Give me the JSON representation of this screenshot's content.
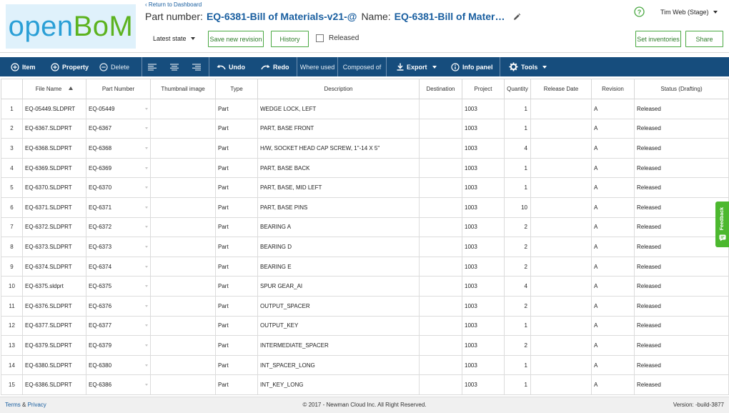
{
  "header": {
    "logo": {
      "open": "open",
      "bom": "BoM"
    },
    "return_link": "‹ Return to Dashboard",
    "part_number_label": "Part number:",
    "part_number_value": "EQ-6381-Bill of Materials-v21-@",
    "name_label": "Name:",
    "name_value": "EQ-6381-Bill of Mater…",
    "state_dropdown": "Latest state",
    "save_revision_label": "Save new revision",
    "history_label": "History",
    "released_label": "Released",
    "released_checked": false,
    "user": "Tim Web (Stage)",
    "set_inventories_label": "Set inventories",
    "share_label": "Share"
  },
  "toolbar": {
    "item": "Item",
    "property": "Property",
    "delete": "Delete",
    "undo": "Undo",
    "redo": "Redo",
    "where_used": "Where used",
    "composed_of": "Composed of",
    "export": "Export",
    "info_panel": "Info panel",
    "tools": "Tools"
  },
  "table": {
    "columns": [
      "",
      "File Name",
      "Part Number",
      "Thumbnail image",
      "Type",
      "Description",
      "Destination",
      "Project",
      "Quantity",
      "Release Date",
      "Revision",
      "Status (Drafting)"
    ],
    "sorted_column": "File Name",
    "rows": [
      {
        "n": "1",
        "file": "EQ-05449.SLDPRT",
        "part": "EQ-05449",
        "thumb": "",
        "type": "Part",
        "desc": "WEDGE LOCK, LEFT",
        "dest": "",
        "project": "1003",
        "qty": "1",
        "date": "",
        "rev": "A",
        "status": "Released"
      },
      {
        "n": "2",
        "file": "EQ-6367.SLDPRT",
        "part": "EQ-6367",
        "thumb": "",
        "type": "Part",
        "desc": "PART, BASE FRONT",
        "dest": "",
        "project": "1003",
        "qty": "1",
        "date": "",
        "rev": "A",
        "status": "Released"
      },
      {
        "n": "3",
        "file": "EQ-6368.SLDPRT",
        "part": "EQ-6368",
        "thumb": "",
        "type": "Part",
        "desc": "H/W, SOCKET HEAD CAP SCREW, 1\"-14 X 5\"",
        "dest": "",
        "project": "1003",
        "qty": "4",
        "date": "",
        "rev": "A",
        "status": "Released"
      },
      {
        "n": "4",
        "file": "EQ-6369.SLDPRT",
        "part": "EQ-6369",
        "thumb": "",
        "type": "Part",
        "desc": "PART, BASE BACK",
        "dest": "",
        "project": "1003",
        "qty": "1",
        "date": "",
        "rev": "A",
        "status": "Released"
      },
      {
        "n": "5",
        "file": "EQ-6370.SLDPRT",
        "part": "EQ-6370",
        "thumb": "",
        "type": "Part",
        "desc": "PART, BASE, MID LEFT",
        "dest": "",
        "project": "1003",
        "qty": "1",
        "date": "",
        "rev": "A",
        "status": "Released"
      },
      {
        "n": "6",
        "file": "EQ-6371.SLDPRT",
        "part": "EQ-6371",
        "thumb": "",
        "type": "Part",
        "desc": "PART, BASE PINS",
        "dest": "",
        "project": "1003",
        "qty": "10",
        "date": "",
        "rev": "A",
        "status": "Released"
      },
      {
        "n": "7",
        "file": "EQ-6372.SLDPRT",
        "part": "EQ-6372",
        "thumb": "",
        "type": "Part",
        "desc": "BEARING A",
        "dest": "",
        "project": "1003",
        "qty": "2",
        "date": "",
        "rev": "A",
        "status": "Released"
      },
      {
        "n": "8",
        "file": "EQ-6373.SLDPRT",
        "part": "EQ-6373",
        "thumb": "",
        "type": "Part",
        "desc": "BEARING D",
        "dest": "",
        "project": "1003",
        "qty": "2",
        "date": "",
        "rev": "A",
        "status": "Released"
      },
      {
        "n": "9",
        "file": "EQ-6374.SLDPRT",
        "part": "EQ-6374",
        "thumb": "",
        "type": "Part",
        "desc": "BEARING E",
        "dest": "",
        "project": "1003",
        "qty": "2",
        "date": "",
        "rev": "A",
        "status": "Released"
      },
      {
        "n": "10",
        "file": "EQ-6375.sldprt",
        "part": "EQ-6375",
        "thumb": "",
        "type": "Part",
        "desc": "SPUR GEAR_AI",
        "dest": "",
        "project": "1003",
        "qty": "4",
        "date": "",
        "rev": "A",
        "status": "Released"
      },
      {
        "n": "11",
        "file": "EQ-6376.SLDPRT",
        "part": "EQ-6376",
        "thumb": "",
        "type": "Part",
        "desc": "OUTPUT_SPACER",
        "dest": "",
        "project": "1003",
        "qty": "2",
        "date": "",
        "rev": "A",
        "status": "Released"
      },
      {
        "n": "12",
        "file": "EQ-6377.SLDPRT",
        "part": "EQ-6377",
        "thumb": "",
        "type": "Part",
        "desc": "OUTPUT_KEY",
        "dest": "",
        "project": "1003",
        "qty": "1",
        "date": "",
        "rev": "A",
        "status": "Released"
      },
      {
        "n": "13",
        "file": "EQ-6379.SLDPRT",
        "part": "EQ-6379",
        "thumb": "",
        "type": "Part",
        "desc": "INTERMEDIATE_SPACER",
        "dest": "",
        "project": "1003",
        "qty": "2",
        "date": "",
        "rev": "A",
        "status": "Released"
      },
      {
        "n": "14",
        "file": "EQ-6380.SLDPRT",
        "part": "EQ-6380",
        "thumb": "",
        "type": "Part",
        "desc": "INT_SPACER_LONG",
        "dest": "",
        "project": "1003",
        "qty": "1",
        "date": "",
        "rev": "A",
        "status": "Released"
      },
      {
        "n": "15",
        "file": "EQ-6386.SLDPRT",
        "part": "EQ-6386",
        "thumb": "",
        "type": "Part",
        "desc": "INT_KEY_LONG",
        "dest": "",
        "project": "1003",
        "qty": "1",
        "date": "",
        "rev": "A",
        "status": "Released"
      }
    ]
  },
  "feedback_label": "Feedback",
  "footer": {
    "terms": "Terms",
    "amp": " & ",
    "privacy": "Privacy",
    "copyright": "© 2017 - Newman Cloud Inc. All Right Reserved.",
    "version": "Version: -build-3877"
  },
  "colors": {
    "toolbar": "#164d7d",
    "accent_blue": "#1a5fa0",
    "accent_green": "#4aa842",
    "logo_bg": "#dff1fb"
  },
  "icons": {
    "help": "help-circle-icon",
    "edit": "pencil-icon",
    "item": "plus-circle-icon",
    "property": "plus-circle-icon",
    "delete": "minus-circle-icon",
    "align_left": "align-left-icon",
    "align_center": "align-center-icon",
    "align_right": "align-right-icon",
    "undo": "undo-arrow-icon",
    "redo": "redo-arrow-icon",
    "export": "download-icon",
    "info": "info-circle-icon",
    "tools": "gear-icon",
    "feedback": "chat-bubble-icon"
  }
}
